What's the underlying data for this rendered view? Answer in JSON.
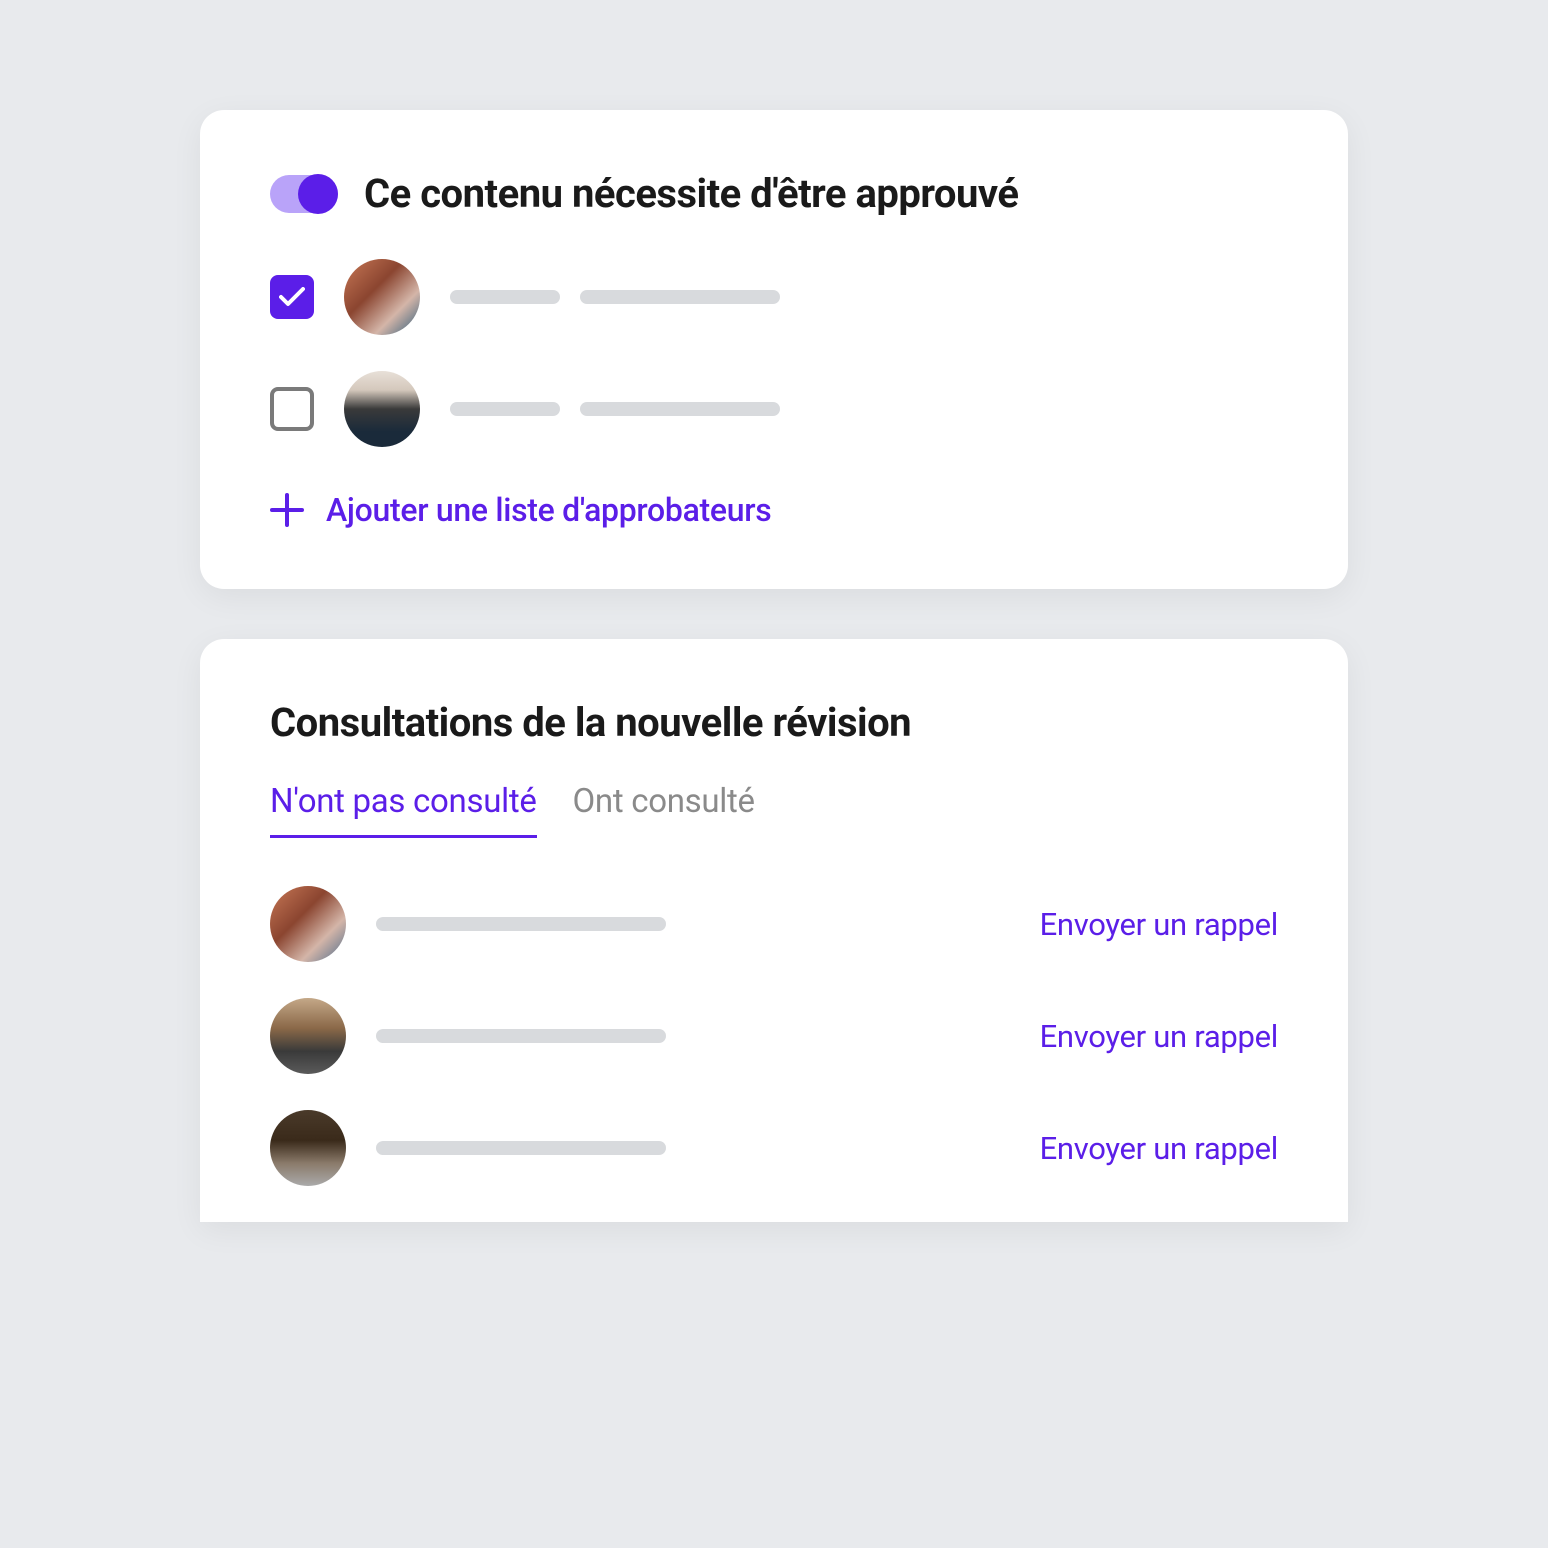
{
  "approval_card": {
    "toggle_label": "Ce contenu nécessite d'être approuvé",
    "toggle_on": true,
    "approvers": [
      {
        "checked": true,
        "avatar_class": "avatar-1"
      },
      {
        "checked": false,
        "avatar_class": "avatar-2"
      }
    ],
    "add_label": "Ajouter une liste d'approbateurs"
  },
  "consult_card": {
    "title": "Consultations de la nouvelle révision",
    "tabs": [
      {
        "label": "N'ont pas consulté",
        "active": true
      },
      {
        "label": "Ont consulté",
        "active": false
      }
    ],
    "rows": [
      {
        "avatar_class": "avatar-3",
        "action": "Envoyer un rappel"
      },
      {
        "avatar_class": "avatar-4",
        "action": "Envoyer un rappel"
      },
      {
        "avatar_class": "avatar-5",
        "action": "Envoyer un rappel"
      }
    ]
  },
  "colors": {
    "accent": "#5b1ee8",
    "accent_light": "#b9a3f9"
  }
}
